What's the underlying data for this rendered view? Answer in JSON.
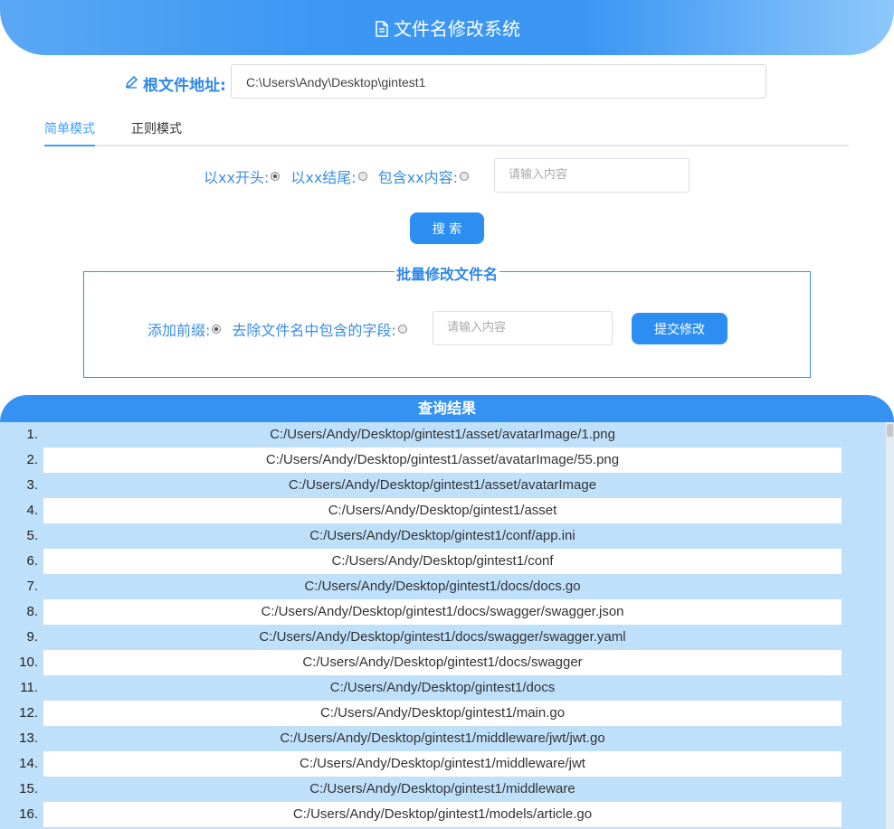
{
  "header": {
    "title": "文件名修改系统",
    "icon": "document-icon"
  },
  "root": {
    "label": "根文件地址:",
    "value": "C:\\Users\\Andy\\Desktop\\gintest1",
    "icon": "pencil-icon"
  },
  "tabs": [
    {
      "label": "简单模式",
      "active": true
    },
    {
      "label": "正则模式",
      "active": false
    }
  ],
  "search": {
    "options": [
      {
        "label": "以xx开头:",
        "checked": true
      },
      {
        "label": "以xx结尾:",
        "checked": false
      },
      {
        "label": "包含xx内容:",
        "checked": false
      }
    ],
    "placeholder": "请输入内容",
    "button": "搜 索"
  },
  "batch": {
    "title": "批量修改文件名",
    "options": [
      {
        "label": "添加前缀:",
        "checked": true
      },
      {
        "label": "去除文件名中包含的字段:",
        "checked": false
      }
    ],
    "placeholder": "请输入内容",
    "button": "提交修改"
  },
  "results": {
    "title": "查询结果",
    "rows": [
      {
        "index": "1.",
        "path": "C:/Users/Andy/Desktop/gintest1/asset/avatarImage/1.png"
      },
      {
        "index": "2.",
        "path": "C:/Users/Andy/Desktop/gintest1/asset/avatarImage/55.png"
      },
      {
        "index": "3.",
        "path": "C:/Users/Andy/Desktop/gintest1/asset/avatarImage"
      },
      {
        "index": "4.",
        "path": "C:/Users/Andy/Desktop/gintest1/asset"
      },
      {
        "index": "5.",
        "path": "C:/Users/Andy/Desktop/gintest1/conf/app.ini"
      },
      {
        "index": "6.",
        "path": "C:/Users/Andy/Desktop/gintest1/conf"
      },
      {
        "index": "7.",
        "path": "C:/Users/Andy/Desktop/gintest1/docs/docs.go"
      },
      {
        "index": "8.",
        "path": "C:/Users/Andy/Desktop/gintest1/docs/swagger/swagger.json"
      },
      {
        "index": "9.",
        "path": "C:/Users/Andy/Desktop/gintest1/docs/swagger/swagger.yaml"
      },
      {
        "index": "10.",
        "path": "C:/Users/Andy/Desktop/gintest1/docs/swagger"
      },
      {
        "index": "11.",
        "path": "C:/Users/Andy/Desktop/gintest1/docs"
      },
      {
        "index": "12.",
        "path": "C:/Users/Andy/Desktop/gintest1/main.go"
      },
      {
        "index": "13.",
        "path": "C:/Users/Andy/Desktop/gintest1/middleware/jwt/jwt.go"
      },
      {
        "index": "14.",
        "path": "C:/Users/Andy/Desktop/gintest1/middleware/jwt"
      },
      {
        "index": "15.",
        "path": "C:/Users/Andy/Desktop/gintest1/middleware"
      },
      {
        "index": "16.",
        "path": "C:/Users/Andy/Desktop/gintest1/models/article.go"
      }
    ]
  },
  "colors": {
    "accent": "#409eff",
    "header": "#3a95f3",
    "results_bg": "#bfe0fb"
  }
}
